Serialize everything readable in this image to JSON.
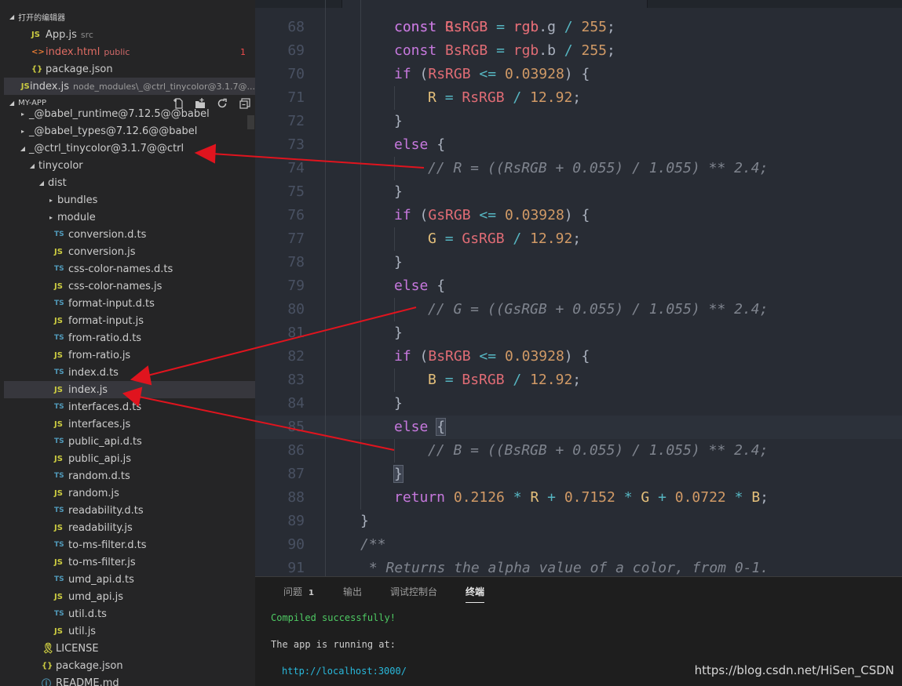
{
  "open_editors": {
    "header": "打开的编辑器",
    "items": [
      {
        "icon": "JS",
        "name": "App.js",
        "hint": "src"
      },
      {
        "icon": "<>",
        "name": "index.html",
        "hint": "public",
        "badge": "1"
      },
      {
        "icon": "{}",
        "name": "package.json",
        "hint": ""
      },
      {
        "icon": "JS",
        "name": "index.js",
        "hint": "node_modules\\_@ctrl_tinycolor@3.1.7@..."
      }
    ]
  },
  "explorer": {
    "header": "MY-APP",
    "tree": [
      {
        "label": "_@babel_runtime@7.12.5@@babel",
        "twist": "▸"
      },
      {
        "label": "_@babel_types@7.12.6@@babel",
        "twist": "▸"
      },
      {
        "label": "_@ctrl_tinycolor@3.1.7@@ctrl",
        "twist": "◢"
      },
      {
        "label": "tinycolor",
        "twist": "◢"
      },
      {
        "label": "dist",
        "twist": "◢"
      },
      {
        "label": "bundles",
        "twist": "▸"
      },
      {
        "label": "module",
        "twist": "▸"
      },
      {
        "label": "conversion.d.ts",
        "icon": "TS"
      },
      {
        "label": "conversion.js",
        "icon": "JS"
      },
      {
        "label": "css-color-names.d.ts",
        "icon": "TS"
      },
      {
        "label": "css-color-names.js",
        "icon": "JS"
      },
      {
        "label": "format-input.d.ts",
        "icon": "TS"
      },
      {
        "label": "format-input.js",
        "icon": "JS"
      },
      {
        "label": "from-ratio.d.ts",
        "icon": "TS"
      },
      {
        "label": "from-ratio.js",
        "icon": "JS"
      },
      {
        "label": "index.d.ts",
        "icon": "TS"
      },
      {
        "label": "index.js",
        "icon": "JS"
      },
      {
        "label": "interfaces.d.ts",
        "icon": "TS"
      },
      {
        "label": "interfaces.js",
        "icon": "JS"
      },
      {
        "label": "public_api.d.ts",
        "icon": "TS"
      },
      {
        "label": "public_api.js",
        "icon": "JS"
      },
      {
        "label": "random.d.ts",
        "icon": "TS"
      },
      {
        "label": "random.js",
        "icon": "JS"
      },
      {
        "label": "readability.d.ts",
        "icon": "TS"
      },
      {
        "label": "readability.js",
        "icon": "JS"
      },
      {
        "label": "to-ms-filter.d.ts",
        "icon": "TS"
      },
      {
        "label": "to-ms-filter.js",
        "icon": "JS"
      },
      {
        "label": "umd_api.d.ts",
        "icon": "TS"
      },
      {
        "label": "umd_api.js",
        "icon": "JS"
      },
      {
        "label": "util.d.ts",
        "icon": "TS"
      },
      {
        "label": "util.js",
        "icon": "JS"
      },
      {
        "label": "LICENSE",
        "icon": "LIC"
      },
      {
        "label": "package.json",
        "icon": "{}"
      },
      {
        "label": "README.md",
        "icon": "ⓘ"
      }
    ]
  },
  "editor": {
    "line_numbers": [
      "68",
      "69",
      "70",
      "71",
      "72",
      "73",
      "74",
      "75",
      "76",
      "77",
      "78",
      "79",
      "80",
      "81",
      "82",
      "83",
      "84",
      "85",
      "86",
      "87",
      "88",
      "89",
      "90",
      "91"
    ],
    "tokens": {
      "const": "const",
      "if": "if",
      "else": "else",
      "return": "return",
      "rgb": "rgb",
      "div": "/",
      "lte": "<=",
      "eq": "=",
      "mul": "*",
      "plus": "+",
      "R": "R",
      "G": "G",
      "B": "B",
      "GsRGB": "GsRGB",
      "BsRGB": "BsRGB",
      "RsRGB": "RsRGB",
      "g": ".g",
      "b": ".b",
      "n255": "255",
      "n03928": "0.03928",
      "n1292": "12.92",
      "n2126": "0.2126",
      "n7152": "0.7152",
      "n0722": "0.0722",
      "lb": "{",
      "rb": "}",
      "lp": "(",
      "rp": ")",
      "semi": ";",
      "c74": "// R = ((RsRGB + 0.055) / 1.055) ** 2.4;",
      "c80": "// G = ((GsRGB + 0.055) / 1.055) ** 2.4;",
      "c86": "// B = ((BsRGB + 0.055) / 1.055) ** 2.4;",
      "doc_open": "/**",
      "doc_line": " * Returns the alpha value of a color, from 0-1."
    }
  },
  "panel": {
    "tabs": [
      {
        "label": "问题",
        "badge": "1"
      },
      {
        "label": "输出"
      },
      {
        "label": "调试控制台"
      },
      {
        "label": "终端"
      }
    ],
    "terminal": {
      "line1": "Compiled successfully!",
      "line2": "The app is running at:",
      "line3": "http://localhost:3000/"
    }
  },
  "watermark": "https://blog.csdn.net/HiSen_CSDN",
  "colors": {
    "arrow": "#e0141e",
    "keyword": "#c678dd",
    "variable": "#e06c75",
    "number": "#d19a66",
    "operator": "#56b6c2",
    "comment": "#7f848e"
  }
}
